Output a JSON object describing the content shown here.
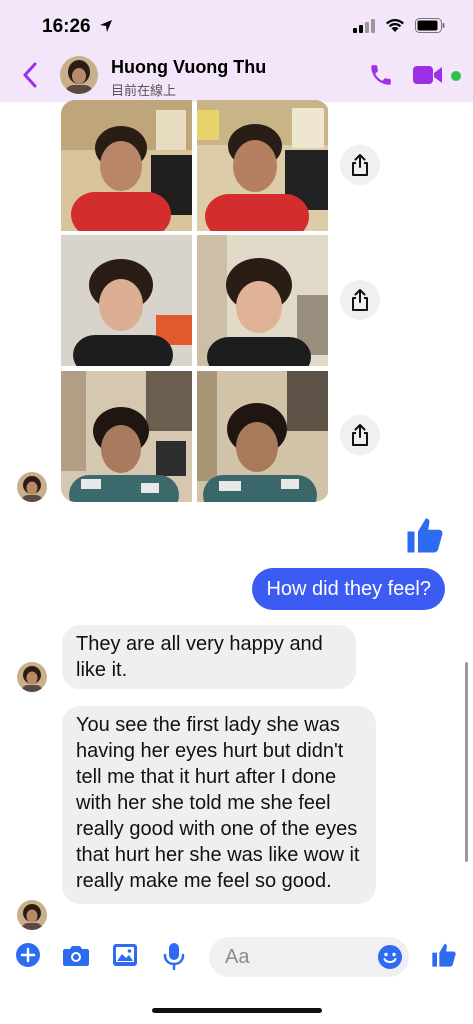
{
  "status_bar": {
    "time": "16:26"
  },
  "header": {
    "name": "Huong Vuong Thu",
    "status": "目前在線上"
  },
  "messages": {
    "outgoing_text": "How did they feel?",
    "incoming_1": "They are all very happy and like it.",
    "incoming_2": "You see the first lady she was having her eyes hurt but didn't tell me that it hurt after I done with her she told me she feel really good with one of the eyes that hurt her she was like wow it really make me feel so good."
  },
  "composer": {
    "placeholder": "Aa"
  },
  "colors": {
    "accent": "#9b30e6",
    "messenger_blue": "#3b5bf3",
    "online": "#31c24c"
  }
}
